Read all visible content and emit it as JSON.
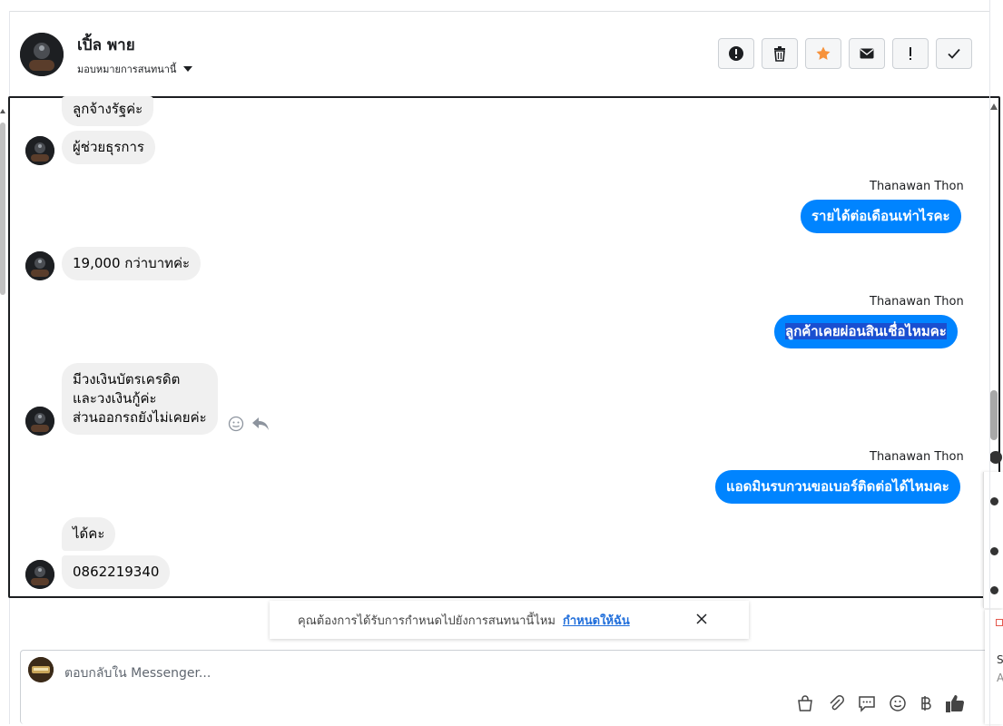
{
  "header": {
    "name": "เปิ้ล พาย",
    "assign_label": "มอบหมายการสนทนานี้"
  },
  "toolbar": {
    "buttons": [
      "spam-icon",
      "trash-icon",
      "star-icon",
      "mail-icon",
      "important-icon",
      "check-icon"
    ]
  },
  "messages": {
    "m1": "ลูกจ้างรัฐค่ะ",
    "m2": "ผู้ช่วยธุรการ",
    "sender1": "Thanawan Thon",
    "m3": "รายได้ต่อเดือนเท่าไรคะ",
    "m4": "19,000 กว่าบาทค่ะ",
    "sender2": "Thanawan Thon",
    "m5": "ลูกค้าเคยผ่อนสินเชื่อไหมคะ",
    "m6_line1": "มีวงเงินบัตรเครดิต",
    "m6_line2": "และวงเงินกู้ค่ะ",
    "m6_line3": "ส่วนออกรถยังไม่เคยค่ะ",
    "sender3": "Thanawan Thon",
    "m7": "แอดมินรบกวนขอเบอร์ติดต่อได้ไหมคะ",
    "m8": "ได้คะ",
    "m9": "0862219340"
  },
  "banner": {
    "text": "คุณต้องการได้รับการกำหนดไปยังการสนทนานี้ไหม",
    "link": "กำหนดให้ฉัน"
  },
  "composer": {
    "placeholder": "ตอบกลับใน Messenger..."
  },
  "side": {
    "letter1": "S",
    "letter2": "A"
  },
  "colors": {
    "outgoing": "#0084ff",
    "incoming": "#f0f0f0",
    "star": "#f7923b",
    "link": "#216fdb"
  }
}
